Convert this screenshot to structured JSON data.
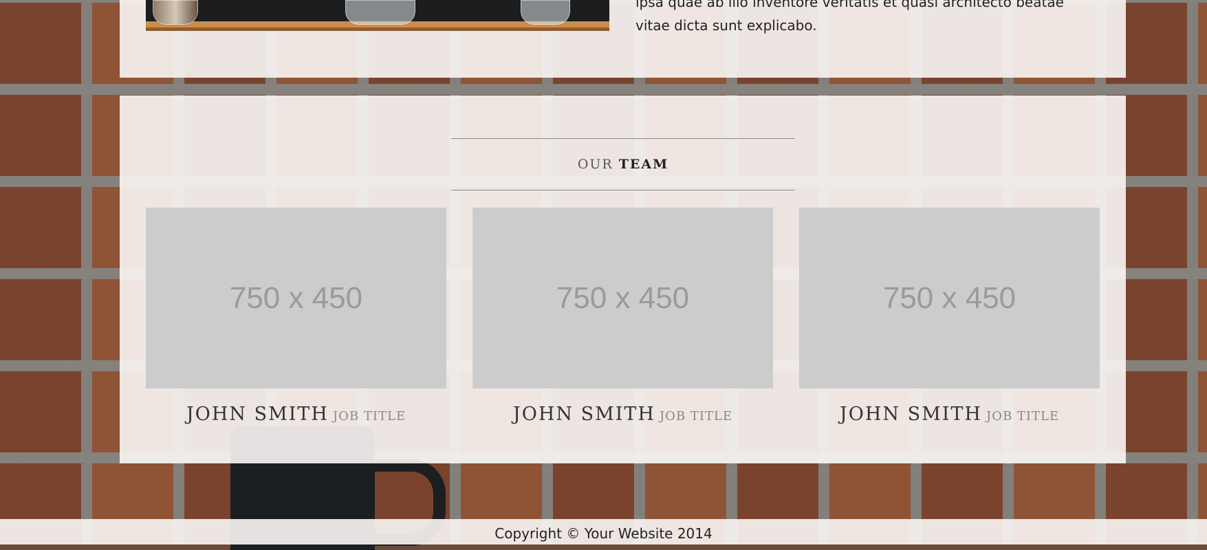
{
  "about": {
    "text": "ipsa quae ab illo inventore veritatis et quasi architecto beatae vitae dicta sunt explicabo."
  },
  "team": {
    "heading_light": "OUR",
    "heading_strong": "TEAM",
    "members": [
      {
        "image_placeholder": "750 x 450",
        "name": "JOHN SMITH",
        "job": "JOB TITLE"
      },
      {
        "image_placeholder": "750 x 450",
        "name": "JOHN SMITH",
        "job": "JOB TITLE"
      },
      {
        "image_placeholder": "750 x 450",
        "name": "JOHN SMITH",
        "job": "JOB TITLE"
      }
    ]
  },
  "footer": {
    "copyright": "Copyright © Your Website 2014"
  },
  "colors": {
    "panel_background": "#f8f5f3",
    "placeholder_background": "#cccccc",
    "placeholder_text": "#9a9a9a"
  }
}
